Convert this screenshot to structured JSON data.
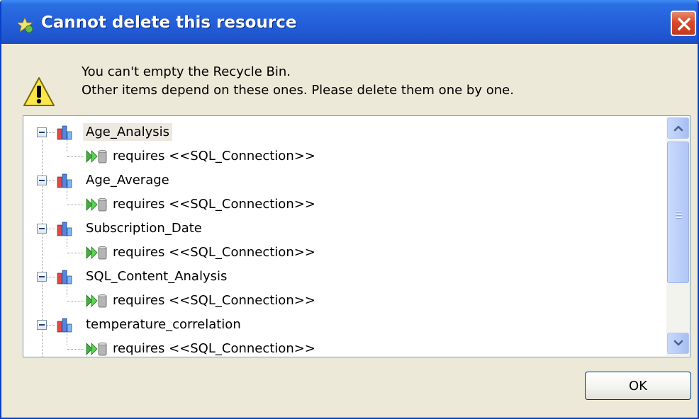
{
  "window": {
    "title": "Cannot delete this resource",
    "close_icon": "close-icon"
  },
  "message": {
    "line1": "You can't empty the Recycle Bin.",
    "line2": "Other items depend on these ones. Please delete them one by one."
  },
  "tree": {
    "items": [
      {
        "label": "Age_Analysis",
        "dependency": "requires <<SQL_Connection>>",
        "selected": true
      },
      {
        "label": "Age_Average",
        "dependency": "requires <<SQL_Connection>>"
      },
      {
        "label": "Subscription_Date",
        "dependency": "requires <<SQL_Connection>>"
      },
      {
        "label": "SQL_Content_Analysis",
        "dependency": "requires <<SQL_Connection>>"
      },
      {
        "label": "temperature_correlation",
        "dependency": "requires <<SQL_Connection>>"
      }
    ]
  },
  "buttons": {
    "ok": "OK"
  },
  "colors": {
    "title_bar": "#2460da",
    "dialog_bg": "#ece9d8",
    "close_red": "#d7492a",
    "selection": "#ede9e1"
  }
}
